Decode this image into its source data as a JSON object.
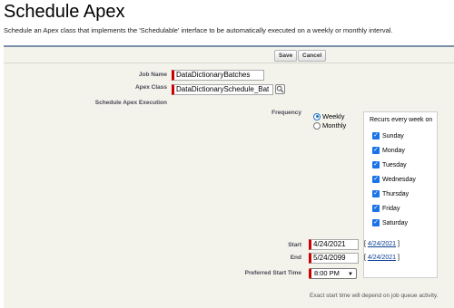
{
  "page": {
    "title": "Schedule Apex",
    "description": "Schedule an Apex class that implements the 'Schedulable' interface to be automatically executed on a weekly or monthly interval."
  },
  "toolbar": {
    "save_label": "Save",
    "cancel_label": "Cancel"
  },
  "form": {
    "job_name_label": "Job Name",
    "job_name_value": "DataDictionaryBatches",
    "apex_class_label": "Apex Class",
    "apex_class_value": "DataDictionarySchedule_Bat",
    "execution_label": "Schedule Apex Execution",
    "frequency_label": "Frequency",
    "frequency_options": [
      "Weekly",
      "Monthly"
    ],
    "frequency_selected": "Weekly",
    "recurs_label": "Recurs every week on",
    "days": [
      "Sunday",
      "Monday",
      "Tuesday",
      "Wednesday",
      "Thursday",
      "Friday",
      "Saturday"
    ],
    "start_label": "Start",
    "start_value": "4/24/2021",
    "start_link": "4/24/2021",
    "end_label": "End",
    "end_value": "5/24/2099",
    "end_link": "4/24/2021",
    "preferred_label": "Preferred Start Time",
    "preferred_value": "8:00 PM",
    "footnote": "Exact start time will depend on job queue activity."
  },
  "icons": {
    "lookup": "lookup-icon",
    "check": "checkbox-checked-icon",
    "dropdown": "chevron-down-icon"
  },
  "colors": {
    "required_bar": "#cc0000",
    "checkbox": "#1a73e8",
    "panel_border": "#7a8ea8"
  }
}
